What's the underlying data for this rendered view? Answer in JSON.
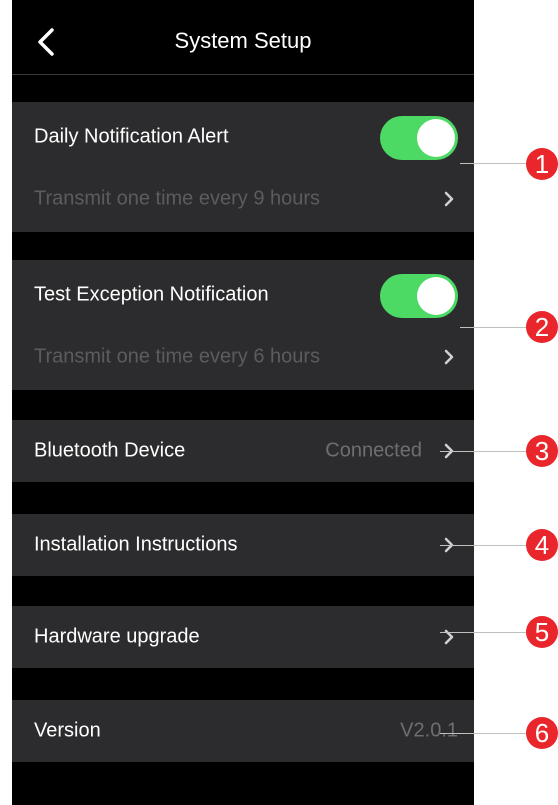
{
  "header": {
    "title": "System Setup",
    "back_icon": "chevron-left-icon"
  },
  "settings": {
    "daily_alert": {
      "label": "Daily Notification Alert",
      "enabled": true,
      "interval_text": "Transmit one time every 9 hours"
    },
    "test_exception": {
      "label": "Test Exception Notification",
      "enabled": true,
      "interval_text": "Transmit one time every 6 hours"
    },
    "bluetooth": {
      "label": "Bluetooth Device",
      "status": "Connected"
    },
    "installation": {
      "label": "Installation Instructions"
    },
    "hardware": {
      "label": "Hardware upgrade"
    },
    "version": {
      "label": "Version",
      "value": "V2.0.1"
    }
  },
  "callouts": [
    "1",
    "2",
    "3",
    "4",
    "5",
    "6"
  ],
  "colors": {
    "background": "#000000",
    "card": "#2c2c2e",
    "toggle_on": "#4cd964",
    "badge": "#e8262b",
    "muted_text": "#5c5c60"
  }
}
